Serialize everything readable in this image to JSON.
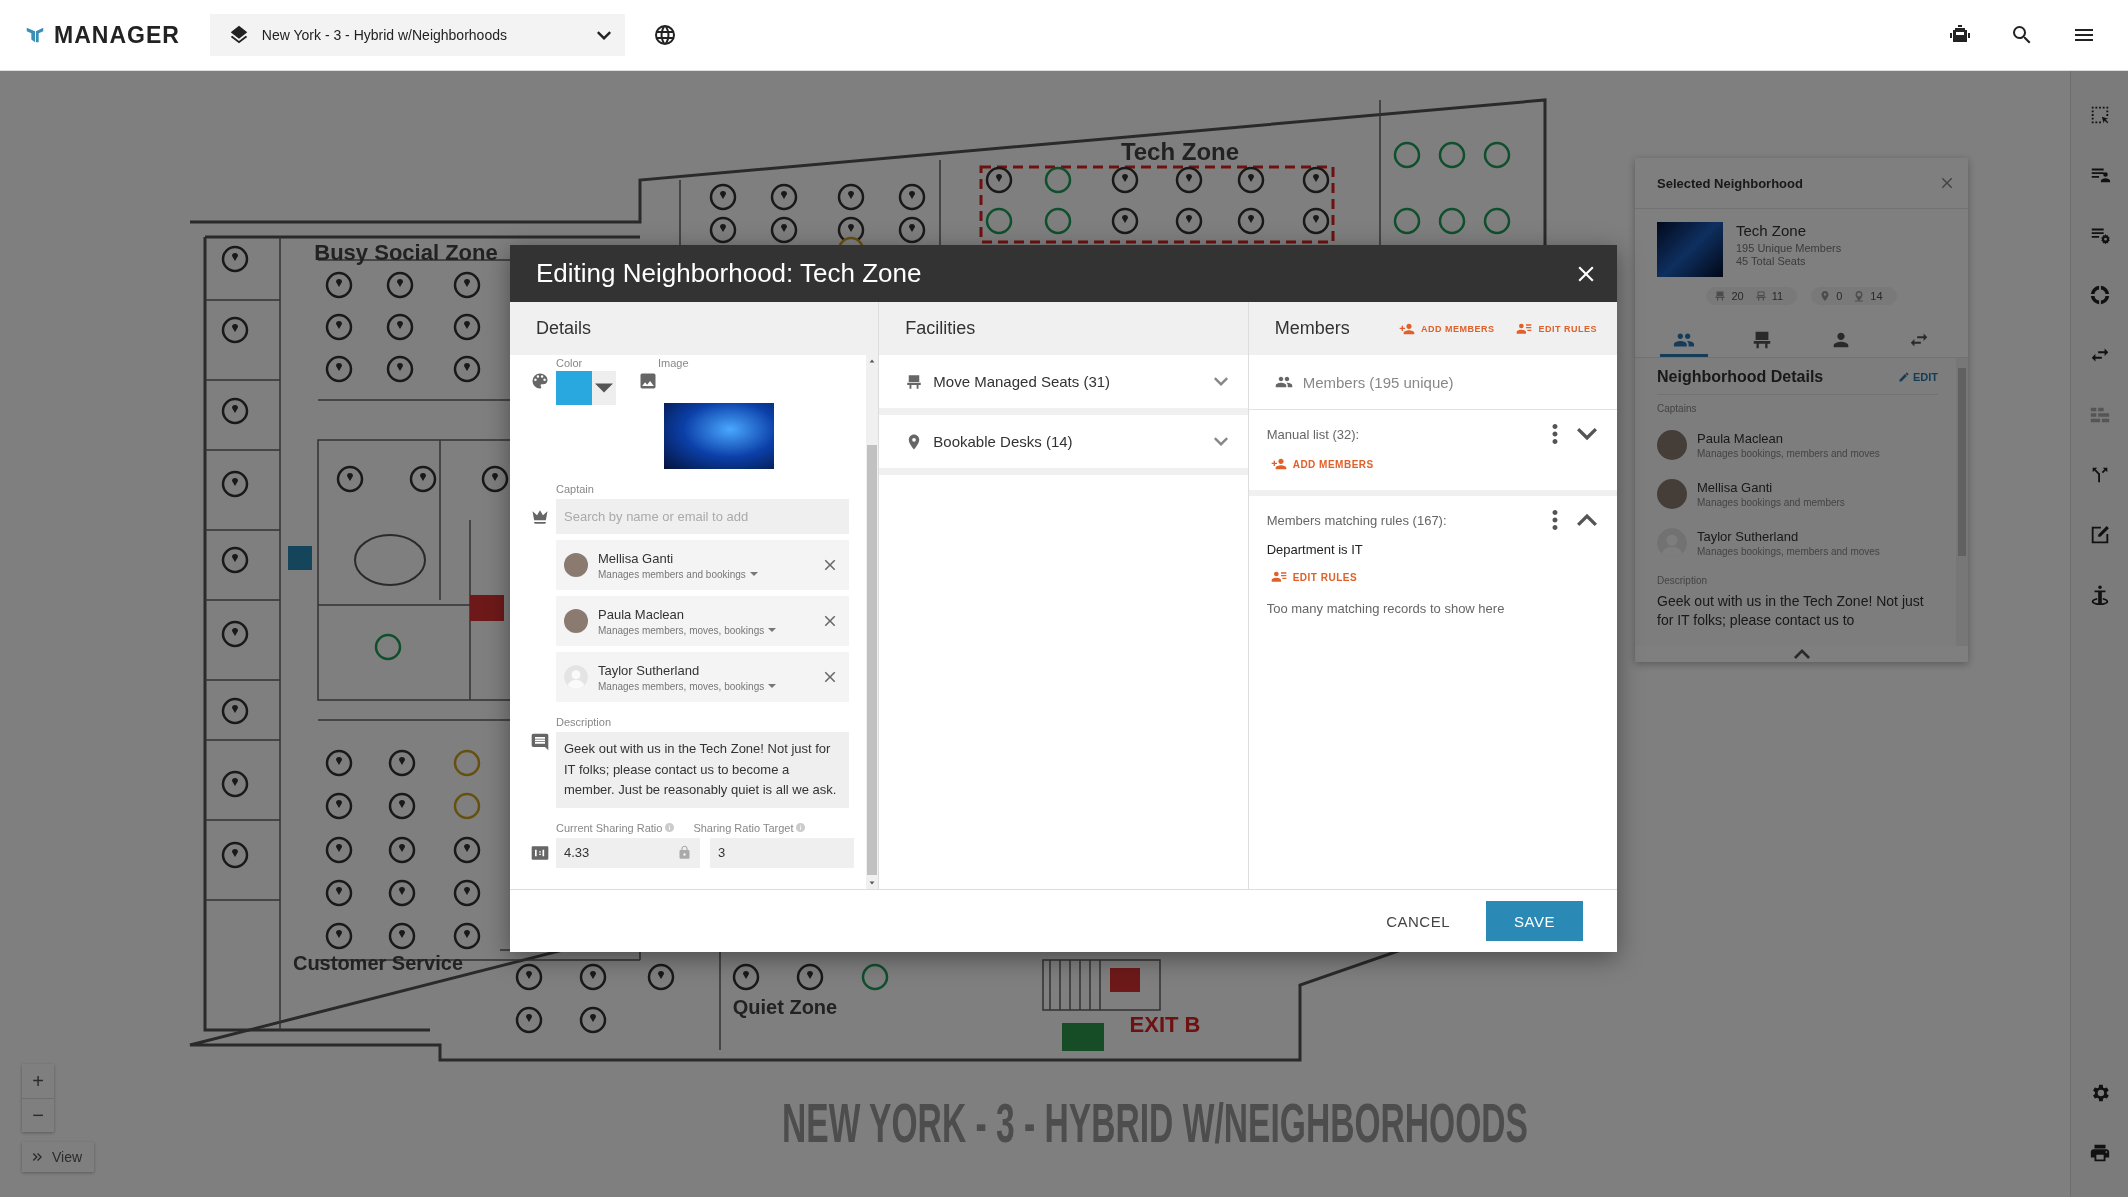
{
  "top_bar": {
    "logo": "MANAGER",
    "floor_selector": "New York - 3 - Hybrid w/Neighborhoods"
  },
  "floor_plan": {
    "title": "NEW YORK - 3 - HYBRID W/NEIGHBORHOODS",
    "zone_labels": [
      {
        "text": "Tech Zone",
        "kind": "zone"
      },
      {
        "text": "Busy Social Zone",
        "kind": "zone"
      },
      {
        "text": "Customer Service",
        "kind": "zone"
      },
      {
        "text": "Quiet Zone",
        "kind": "zone"
      },
      {
        "text": "EXIT B",
        "kind": "exit"
      }
    ]
  },
  "map_controls": {
    "zoom_in": "+",
    "zoom_out": "−",
    "view": "View"
  },
  "right_toolbar": [
    {
      "kind": "select",
      "disabled": false
    },
    {
      "kind": "list-person",
      "disabled": false
    },
    {
      "kind": "list-gear",
      "disabled": false
    },
    {
      "kind": "donut",
      "disabled": false
    },
    {
      "kind": "swap",
      "disabled": false
    },
    {
      "kind": "blocks",
      "disabled": true
    },
    {
      "kind": "fork",
      "disabled": false
    },
    {
      "kind": "edit",
      "disabled": false
    },
    {
      "kind": "accessibility",
      "disabled": false
    },
    {
      "kind": "settings",
      "disabled": false
    },
    {
      "kind": "print",
      "disabled": false
    }
  ],
  "selected_panel": {
    "title": "Selected Neighborhood",
    "name": "Tech Zone",
    "members_line": "195 Unique Members",
    "seats_line": "45 Total Seats",
    "badge_groups": [
      [
        {
          "kind": "seat",
          "value": "20"
        },
        {
          "kind": "seat-outline",
          "value": "11"
        }
      ],
      [
        {
          "kind": "pin",
          "value": "0"
        },
        {
          "kind": "pin-outline",
          "value": "14"
        }
      ]
    ],
    "tabs": [
      {
        "kind": "members",
        "selected": true
      },
      {
        "kind": "seat",
        "selected": false
      },
      {
        "kind": "person",
        "selected": false
      },
      {
        "kind": "swap",
        "selected": false
      }
    ],
    "section_title": "Neighborhood Details",
    "edit": "EDIT",
    "captains_label": "Captains",
    "captains": [
      {
        "name": "Paula Maclean",
        "role": "Manages bookings, members and moves",
        "kind": "photo"
      },
      {
        "name": "Mellisa Ganti",
        "role": "Manages bookings and members",
        "kind": "photo"
      },
      {
        "name": "Taylor Sutherland",
        "role": "Manages bookings, members and moves",
        "kind": "default"
      }
    ],
    "description_label": "Description",
    "description": "Geek out with us in the Tech Zone! Not just for IT folks; please contact us to"
  },
  "dialog": {
    "title": "Editing Neighborhood: Tech Zone",
    "details": {
      "header": "Details",
      "color_label": "Color",
      "color": "#29a8e0",
      "image_label": "Image",
      "captain_label": "Captain",
      "captain_search": {
        "placeholder": "Search by name or email to add"
      },
      "captains": [
        {
          "name": "Mellisa Ganti",
          "role": "Manages members and bookings",
          "kind": "photo"
        },
        {
          "name": "Paula Maclean",
          "role": "Manages members, moves, bookings",
          "kind": "photo"
        },
        {
          "name": "Taylor Sutherland",
          "role": "Manages members, moves, bookings",
          "kind": "default"
        }
      ],
      "description_label": "Description",
      "description": "Geek out with us in the Tech Zone! Not just for IT folks; please contact us to become a member. Just be reasonably quiet is all we ask.",
      "current_ratio_label": "Current Sharing Ratio",
      "current_ratio": "4.33",
      "target_ratio_label": "Sharing Ratio Target",
      "target_ratio": "3"
    },
    "facilities": {
      "header": "Facilities",
      "items": [
        {
          "kind": "seat",
          "label": "Move Managed Seats (31)",
          "expanded": false
        },
        {
          "kind": "pin",
          "label": "Bookable Desks (14)",
          "expanded": false
        }
      ]
    },
    "members": {
      "header": "Members",
      "add_members": "ADD MEMBERS",
      "edit_rules": "EDIT RULES",
      "summary": "Members (195 unique)",
      "manual": {
        "title": "Manual list (32):",
        "expanded": false,
        "action": "ADD MEMBERS"
      },
      "rules": {
        "title": "Members matching rules (167):",
        "expanded": true,
        "rule": "Department is IT",
        "action": "EDIT RULES",
        "note": "Too many matching records to show here"
      }
    },
    "cancel": "CANCEL",
    "save": "SAVE"
  }
}
